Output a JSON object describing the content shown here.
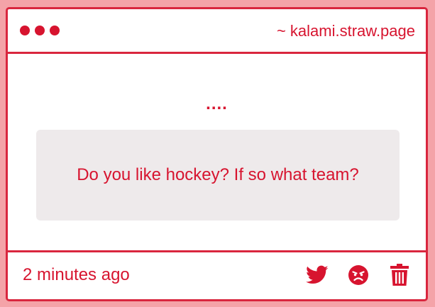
{
  "window": {
    "dots": [
      "dot",
      "dot",
      "dot"
    ],
    "site_label": "~ kalami.straw.page"
  },
  "main": {
    "ellipsis": "....",
    "question": "Do you like hockey? If so what team?"
  },
  "footer": {
    "timestamp": "2 minutes ago",
    "actions": [
      {
        "icon": "twitter-icon"
      },
      {
        "icon": "angry-face-icon"
      },
      {
        "icon": "trash-icon"
      }
    ]
  },
  "colors": {
    "accent": "#d7142f",
    "border": "#d9263e",
    "background": "#f4a3a8",
    "question_box": "#eeeaeb"
  }
}
